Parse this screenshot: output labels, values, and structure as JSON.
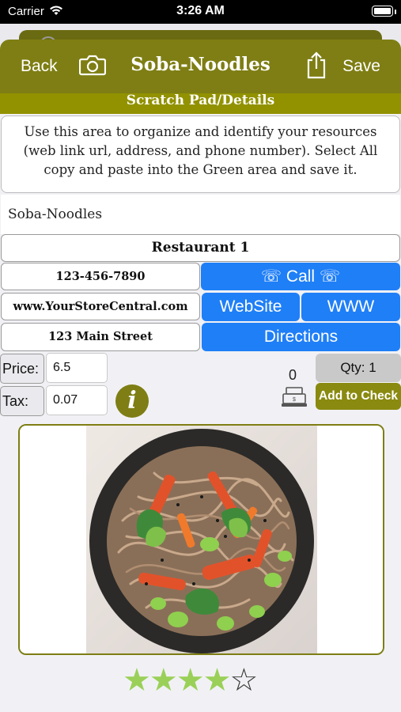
{
  "status_bar": {
    "carrier": "Carrier",
    "time": "3:26 AM"
  },
  "nav": {
    "back_label": "Back",
    "title": "Soba-Noodles",
    "save_label": "Save"
  },
  "section_title": "Scratch Pad/Details",
  "info_text": "Use this area to organize and identify your resources (web link url, address, and phone number). Select All copy and paste into the Green area and save it.",
  "item_name": "Soba-Noodles",
  "details": {
    "title": "Restaurant 1",
    "phone": "123-456-7890",
    "website": "www.YourStoreCentral.com",
    "address": "123 Main Street"
  },
  "buttons": {
    "call": "☏ Call ☏",
    "website": "WebSite",
    "www": "WWW",
    "directions": "Directions",
    "qty": "Qty: 1",
    "add_to_check": "Add to Check",
    "info": "i"
  },
  "fields": {
    "price_label": "Price:",
    "price_value": "6.5",
    "tax_label": "Tax:",
    "tax_value": "0.07"
  },
  "check_count": "0",
  "rating": {
    "value": 4,
    "max": 5,
    "on_color": "#9ad058"
  },
  "colors": {
    "olive": "#7e7e14",
    "section": "#929200",
    "blue": "#1f7ff7"
  }
}
